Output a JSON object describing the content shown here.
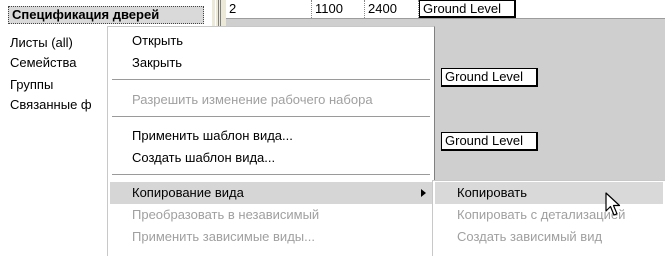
{
  "browser": {
    "selected": "Спецификация дверей",
    "nodes": [
      "Листы (all)",
      "Семейства",
      "Группы",
      "Связанные ф"
    ]
  },
  "grid": {
    "row1": [
      "2",
      "1100",
      "2400",
      "Ground Level"
    ],
    "level_repeat": [
      "Ground Level",
      "Ground Level"
    ]
  },
  "menu": {
    "items": [
      {
        "label": "Открыть",
        "disabled": false
      },
      {
        "label": "Закрыть",
        "disabled": false
      },
      {
        "label": "Разрешить изменение рабочего набора",
        "disabled": true
      },
      {
        "label": "Применить шаблон вида...",
        "disabled": false
      },
      {
        "label": "Создать шаблон вида...",
        "disabled": false
      },
      {
        "label": "Копирование вида",
        "disabled": false,
        "submenu": true
      },
      {
        "label": "Преобразовать в независимый",
        "disabled": true
      },
      {
        "label": "Применить зависимые виды...",
        "disabled": true
      }
    ]
  },
  "submenu": {
    "items": [
      {
        "label": "Копировать",
        "disabled": false
      },
      {
        "label": "Копировать с детализацией",
        "disabled": true
      },
      {
        "label": "Создать зависимый вид",
        "disabled": true
      }
    ]
  },
  "colors": {
    "menu_highlight": "#d6d6d6",
    "disabled_text": "#a0a0a0",
    "grid_background": "#cfcfcf"
  }
}
